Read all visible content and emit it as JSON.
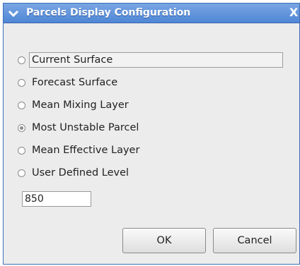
{
  "window": {
    "title": "Parcels Display Configuration",
    "close_glyph": "X"
  },
  "options": [
    {
      "label": "Current Surface",
      "selected": false
    },
    {
      "label": "Forecast Surface",
      "selected": false
    },
    {
      "label": "Mean Mixing Layer",
      "selected": false
    },
    {
      "label": "Most Unstable Parcel",
      "selected": true
    },
    {
      "label": "Mean Effective Layer",
      "selected": false
    },
    {
      "label": "User Defined Level",
      "selected": false
    }
  ],
  "level_input": {
    "value": "850"
  },
  "buttons": {
    "ok": "OK",
    "cancel": "Cancel"
  },
  "colors": {
    "titlebar": "#4f86d6",
    "window_bg": "#ececec"
  }
}
